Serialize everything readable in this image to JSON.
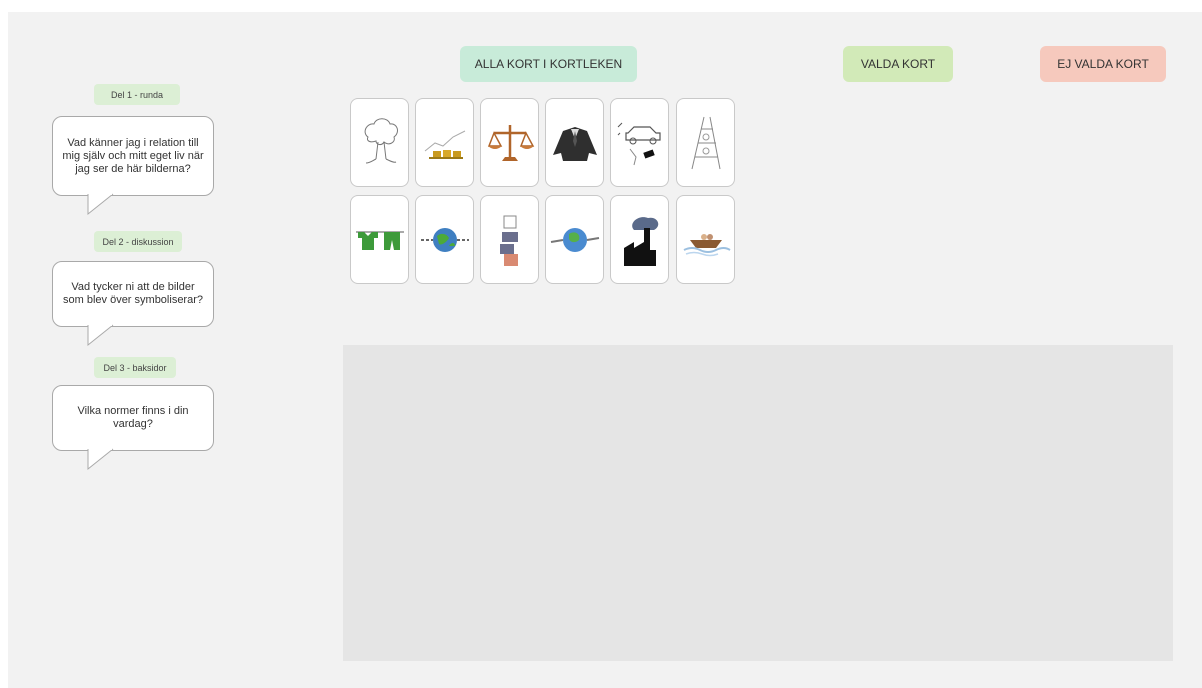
{
  "buttons": {
    "all_cards": "ALLA KORT I KORTLEKEN",
    "chosen": "VALDA KORT",
    "not_chosen": "EJ VALDA KORT"
  },
  "colors": {
    "all_cards_bg": "#c8ebd9",
    "chosen_bg": "#d2eab8",
    "not_chosen_bg": "#f6c9bd",
    "tag_bg": "#dcefd5"
  },
  "sections": [
    {
      "tag": "Del 1 - runda",
      "question": "Vad känner jag i relation till mig själv och mitt eget liv när jag ser de här bilderna?"
    },
    {
      "tag": "Del 2 - diskussion",
      "question": "Vad tycker ni att de bilder som blev över symboliserar?"
    },
    {
      "tag": "Del 3 - baksidor",
      "question": "Vilka normer finns i din vardag?"
    }
  ],
  "cards": [
    {
      "icon": "tree-drawing-icon"
    },
    {
      "icon": "gold-bars-growth-icon"
    },
    {
      "icon": "balance-scale-icon"
    },
    {
      "icon": "suit-person-icon"
    },
    {
      "icon": "car-sketch-icon"
    },
    {
      "icon": "ladder-shelf-icon"
    },
    {
      "icon": "clothesline-icon"
    },
    {
      "icon": "globe-chain-icon"
    },
    {
      "icon": "puzzle-pieces-icon"
    },
    {
      "icon": "globe-hands-icon"
    },
    {
      "icon": "factory-smoke-icon"
    },
    {
      "icon": "boat-water-icon"
    }
  ]
}
